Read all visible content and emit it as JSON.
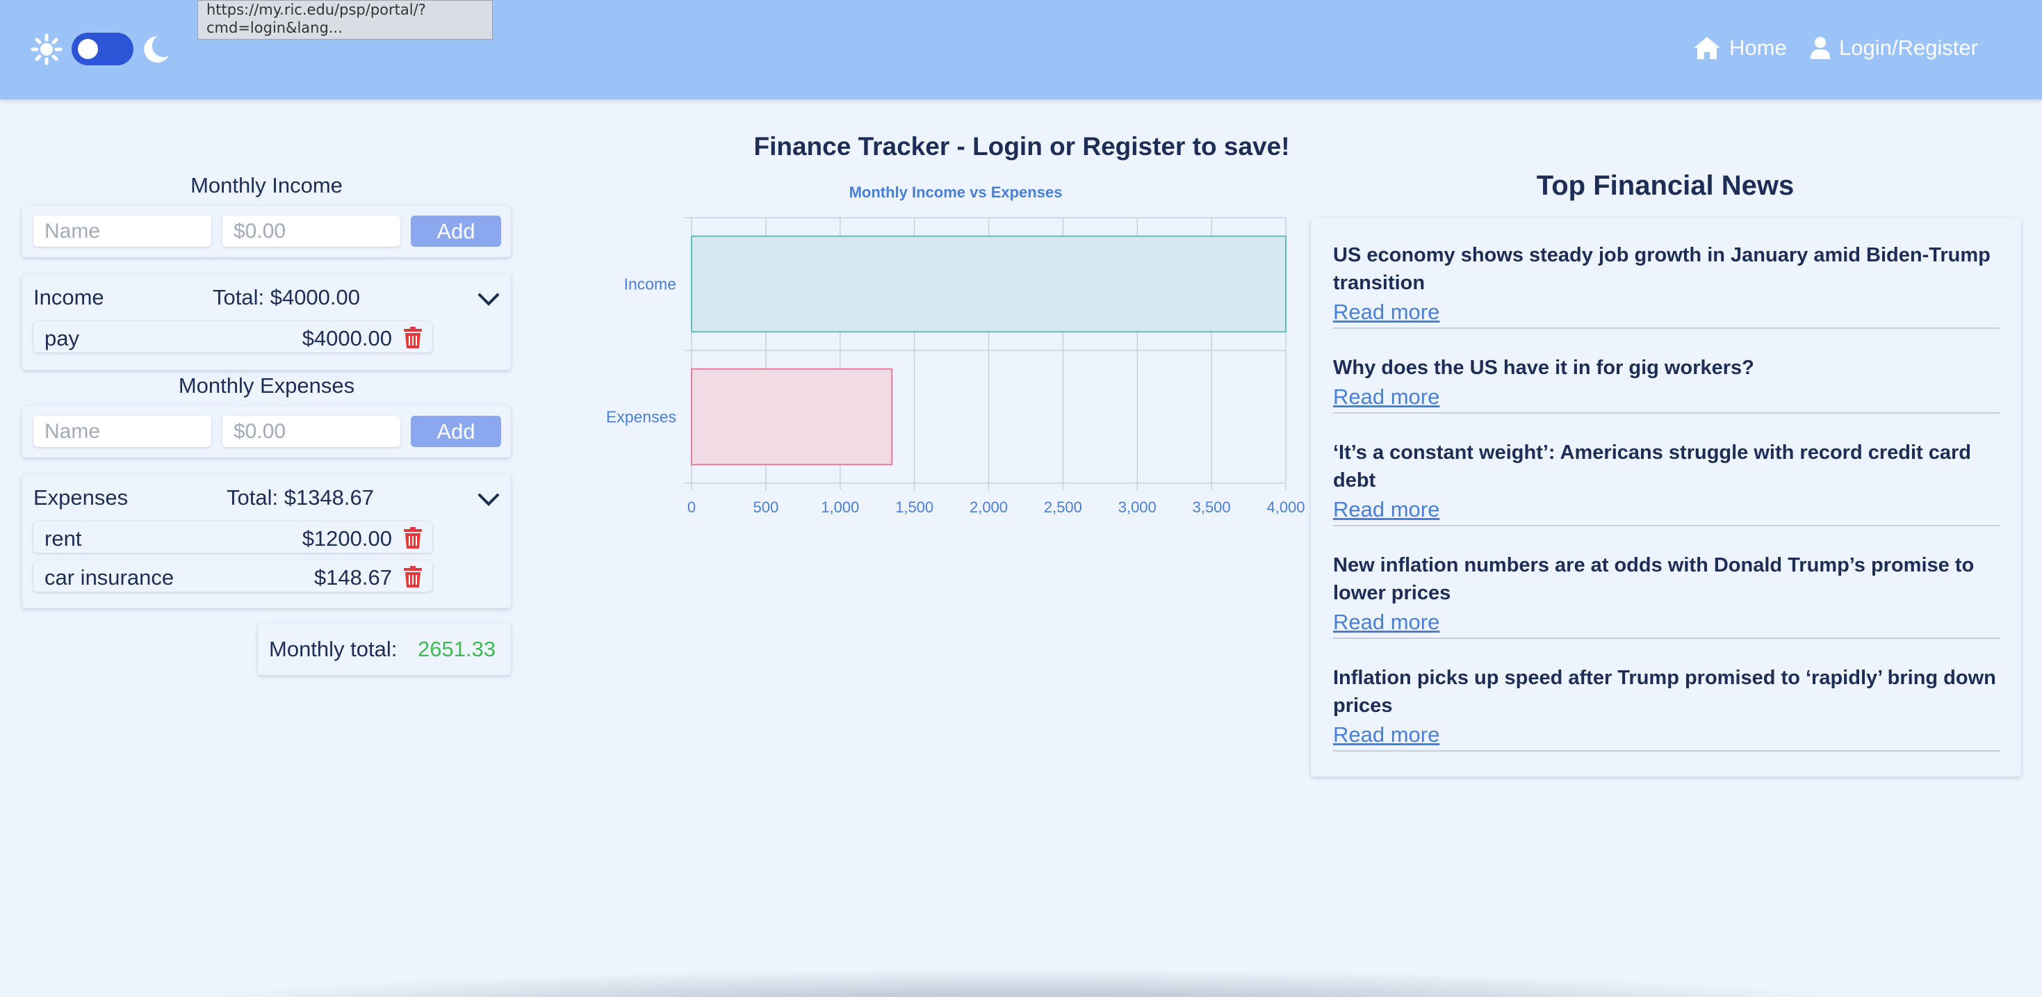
{
  "tooltip": {
    "line1": "https://my.ric.edu/psp/portal/?",
    "line2": "cmd=login&lang..."
  },
  "nav": {
    "home_label": "Home",
    "login_label": "Login/Register"
  },
  "theme_toggle": {
    "state": "light"
  },
  "title": "Finance Tracker - Login or Register to save!",
  "income": {
    "section_title": "Monthly Income",
    "name_placeholder": "Name",
    "amount_placeholder": "$0.00",
    "add_label": "Add",
    "group_label": "Income",
    "total_label": "Total: $4000.00",
    "items": [
      {
        "name": "pay",
        "amount": "$4000.00"
      }
    ]
  },
  "expenses": {
    "section_title": "Monthly Expenses",
    "name_placeholder": "Name",
    "amount_placeholder": "$0.00",
    "add_label": "Add",
    "group_label": "Expenses",
    "total_label": "Total: $1348.67",
    "items": [
      {
        "name": "rent",
        "amount": "$1200.00"
      },
      {
        "name": "car insurance",
        "amount": "$148.67"
      }
    ]
  },
  "summary": {
    "label": "Monthly total:",
    "value": "2651.33"
  },
  "chart_data": {
    "type": "bar",
    "orientation": "horizontal",
    "title": "Monthly Income vs Expenses",
    "categories": [
      "Income",
      "Expenses"
    ],
    "values": [
      4000,
      1348.67
    ],
    "xlim": [
      0,
      4000
    ],
    "xticks": [
      "0",
      "500",
      "1,000",
      "1,500",
      "2,000",
      "2,500",
      "3,000",
      "3,500",
      "4,000"
    ],
    "grid": true,
    "colors": {
      "fills": [
        "#d4e9f0",
        "#f1dbe5"
      ],
      "strokes": [
        "#5fbeb3",
        "#e07f97"
      ],
      "text": "#4a7fd6",
      "grid": "#c8d0dc"
    }
  },
  "news": {
    "title": "Top Financial News",
    "items": [
      {
        "headline": "US economy shows steady job growth in January amid Biden-Trump transition",
        "link": "Read more"
      },
      {
        "headline": "Why does the US have it in for gig workers?",
        "link": "Read more"
      },
      {
        "headline": "‘It’s a constant weight’: Americans struggle with record credit card debt",
        "link": "Read more"
      },
      {
        "headline": "New inflation numbers are at odds with Donald Trump’s promise to lower prices",
        "link": "Read more"
      },
      {
        "headline": "Inflation picks up speed after Trump promised to ‘rapidly’ bring down prices",
        "link": "Read more"
      }
    ]
  }
}
